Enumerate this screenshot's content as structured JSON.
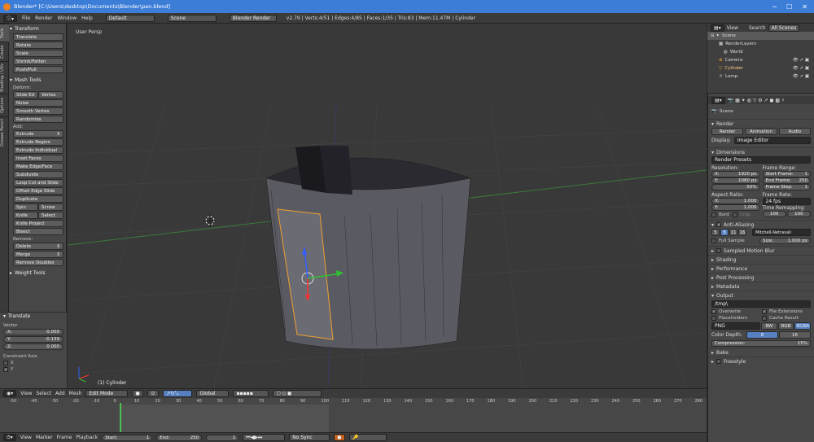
{
  "window": {
    "title": "Blender* [C:\\Users\\desktop\\Documents\\Blender\\pan.blend]"
  },
  "menubar": {
    "items": [
      "File",
      "Render",
      "Window",
      "Help"
    ],
    "layout": "Default",
    "scene": "Scene",
    "engine": "Blender Render",
    "stats": "v2.79 | Verts:4/51 | Edges:4/85 | Faces:1/35 | Tris:83 | Mem:11.47M | Cylinder"
  },
  "left_tabs": [
    "Tools",
    "Create",
    "Shading / UVs",
    "Options",
    "Grease Pencil"
  ],
  "tools": {
    "transform": {
      "header": "Transform",
      "buttons": [
        "Translate",
        "Rotate",
        "Scale",
        "Shrink/Fatten",
        "Push/Pull"
      ]
    },
    "mesh_tools": {
      "header": "Mesh Tools",
      "deform_label": "Deform:",
      "slide_edge": "Slide Ed",
      "vertex": "Vertex",
      "deform_buttons": [
        "Noise",
        "Smooth Vertex",
        "Randomize"
      ],
      "add_label": "Add:",
      "extrude": "Extrude",
      "add_buttons": [
        "Extrude Region",
        "Extrude Individual",
        "Inset Faces",
        "Make Edge/Face",
        "Subdivide",
        "Loop Cut and Slide",
        "Offset Edge Slide",
        "Duplicate"
      ],
      "spin": "Spin",
      "screw": "Screw",
      "knife": "Knife",
      "select": "Select",
      "more_buttons": [
        "Knife Project",
        "Bisect"
      ],
      "remove_label": "Remove:",
      "delete": "Delete",
      "merge": "Merge",
      "remove_doubles": "Remove Doubles"
    },
    "weight_tools": "Weight Tools",
    "translate_op": {
      "header": "Translate",
      "vector_label": "Vector",
      "x": {
        "label": "X:",
        "value": "0.000"
      },
      "y": {
        "label": "Y:",
        "value": "-0.139"
      },
      "z": {
        "label": "Z:",
        "value": "0.000"
      },
      "constraint_label": "Constraint Axis",
      "cx": "X",
      "cy": "Y"
    }
  },
  "viewport": {
    "label": "User Persp",
    "object_label": "(1) Cylinder"
  },
  "viewport_header": {
    "view": "View",
    "select": "Select",
    "add": "Add",
    "mesh": "Mesh",
    "mode": "Edit Mode",
    "orientation": "Global"
  },
  "timeline": {
    "ticks": [
      "-50",
      "-40",
      "-30",
      "-20",
      "-10",
      "0",
      "10",
      "20",
      "30",
      "40",
      "50",
      "60",
      "70",
      "80",
      "90",
      "100",
      "110",
      "120",
      "130",
      "140",
      "150",
      "160",
      "170",
      "180",
      "190",
      "200",
      "210",
      "220",
      "230",
      "240",
      "250",
      "260",
      "270",
      "280"
    ],
    "view": "View",
    "marker": "Marker",
    "frame": "Frame",
    "playback": "Playback",
    "start_label": "Start:",
    "start": "1",
    "end_label": "End:",
    "end": "250",
    "current": "1",
    "sync": "No Sync"
  },
  "outliner": {
    "view": "View",
    "search": "Search",
    "all_scenes": "All Scenes",
    "items": [
      "Scene",
      "RenderLayers",
      "World",
      "Camera",
      "Cylinder",
      "Lamp"
    ]
  },
  "properties": {
    "scene": "Scene",
    "render": {
      "header": "Render",
      "render_btn": "Render",
      "animation_btn": "Animation",
      "audio_btn": "Audio",
      "display_label": "Display:",
      "display": "Image Editor"
    },
    "dimensions": {
      "header": "Dimensions",
      "presets": "Render Presets",
      "resolution_label": "Resolution:",
      "res_x_label": "X:",
      "res_x": "1920 px",
      "res_y_label": "Y:",
      "res_y": "1080 px",
      "res_pct": "50%",
      "frame_range_label": "Frame Range:",
      "start_frame_label": "Start Frame:",
      "start_frame": "1",
      "end_frame_label": "End Frame:",
      "end_frame": "250",
      "frame_step_label": "Frame Step:",
      "frame_step": "1",
      "aspect_label": "Aspect Ratio:",
      "asp_x_label": "X:",
      "asp_x": "1.000",
      "asp_y_label": "Y:",
      "asp_y": "1.000",
      "frame_rate_label": "Frame Rate:",
      "frame_rate": "24 fps",
      "time_remap_label": "Time Remapping:",
      "remap_old": "100",
      "remap_new": "100",
      "border": "Bord",
      "crop": "Crop"
    },
    "anti_aliasing": {
      "header": "Anti-Aliasing",
      "samples": [
        "5",
        "8",
        "11",
        "16"
      ],
      "filter": "Mitchell-Netravali",
      "full_sample": "Full Sample",
      "size_label": "Size:",
      "size": "1.000 px"
    },
    "collapsed_sections": [
      "Sampled Motion Blur",
      "Shading",
      "Performance",
      "Post Processing",
      "Metadata"
    ],
    "output": {
      "header": "Output",
      "path": "/tmp\\",
      "overwrite": "Overwrite",
      "file_extensions": "File Extensions",
      "placeholders": "Placeholders",
      "cache_result": "Cache Result",
      "format": "PNG",
      "bw": "BW",
      "rgb": "RGB",
      "rgba": "RGBA",
      "color_depth_label": "Color Depth:",
      "depth_8": "8",
      "depth_16": "16",
      "compression_label": "Compression:",
      "compression": "15%"
    },
    "bake": "Bake",
    "freestyle": "Freestyle"
  }
}
